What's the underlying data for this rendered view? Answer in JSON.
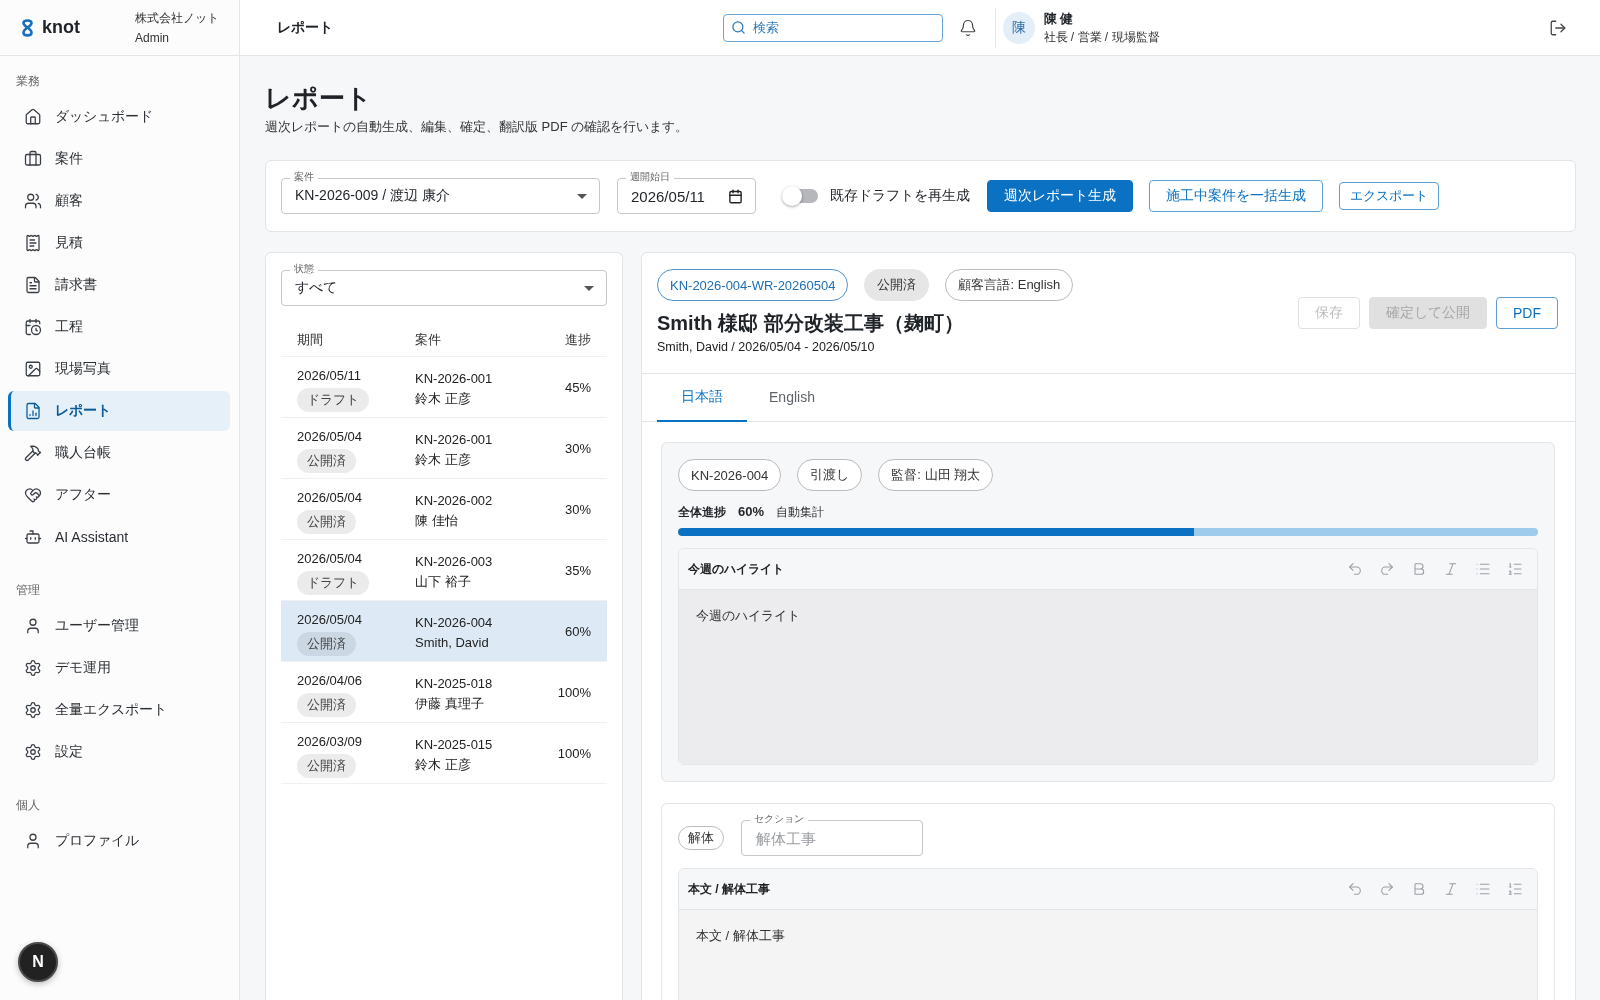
{
  "brand": {
    "name": "knot",
    "company": "株式会社ノット",
    "account": "Admin"
  },
  "sidebar": {
    "sections": [
      {
        "title": "業務",
        "items": [
          {
            "label": "ダッシュボード",
            "selected": false
          },
          {
            "label": "案件",
            "selected": false
          },
          {
            "label": "顧客",
            "selected": false
          },
          {
            "label": "見積",
            "selected": false
          },
          {
            "label": "請求書",
            "selected": false
          },
          {
            "label": "工程",
            "selected": false
          },
          {
            "label": "現場写真",
            "selected": false
          },
          {
            "label": "レポート",
            "selected": true
          },
          {
            "label": "職人台帳",
            "selected": false
          },
          {
            "label": "アフター",
            "selected": false
          },
          {
            "label": "AI Assistant",
            "selected": false
          }
        ]
      },
      {
        "title": "管理",
        "items": [
          {
            "label": "ユーザー管理",
            "selected": false
          },
          {
            "label": "デモ運用",
            "selected": false
          },
          {
            "label": "全量エクスポート",
            "selected": false
          },
          {
            "label": "設定",
            "selected": false
          }
        ]
      },
      {
        "title": "個人",
        "items": [
          {
            "label": "プロファイル",
            "selected": false
          }
        ]
      }
    ],
    "dev_badge": "N"
  },
  "header": {
    "title": "レポート",
    "search": {
      "placeholder": "検索"
    },
    "user": {
      "avatar": "陳",
      "name": "陳 健",
      "roles": "社長 / 営業 / 現場監督"
    }
  },
  "page": {
    "title": "レポート",
    "subtitle": "週次レポートの自動生成、編集、確定、翻訳版 PDF の確認を行います。"
  },
  "filters": {
    "project": {
      "label": "案件",
      "value": "KN-2026-009 / 渡辺 康介"
    },
    "week_start": {
      "label": "週開始日",
      "value": "2026/05/11"
    },
    "regenerate": {
      "label": "既存ドラフトを再生成",
      "on": false
    },
    "buttons": [
      {
        "label": "週次レポート生成",
        "kind": "contained"
      },
      {
        "label": "施工中案件を一括生成",
        "kind": "outlined"
      },
      {
        "label": "エクスポート",
        "kind": "small"
      }
    ]
  },
  "report_list": {
    "status_filter": {
      "label": "状態",
      "value": "すべて"
    },
    "columns": [
      "期間",
      "案件",
      "進捗"
    ],
    "rows": [
      {
        "period": "2026/05/11",
        "status": "ドラフト",
        "project": "KN-2026-001",
        "client": "鈴木 正彦",
        "progress": "45%",
        "selected": false
      },
      {
        "period": "2026/05/04",
        "status": "公開済",
        "project": "KN-2026-001",
        "client": "鈴木 正彦",
        "progress": "30%",
        "selected": false
      },
      {
        "period": "2026/05/04",
        "status": "公開済",
        "project": "KN-2026-002",
        "client": "陳 佳怡",
        "progress": "30%",
        "selected": false
      },
      {
        "period": "2026/05/04",
        "status": "ドラフト",
        "project": "KN-2026-003",
        "client": "山下 裕子",
        "progress": "35%",
        "selected": false
      },
      {
        "period": "2026/05/04",
        "status": "公開済",
        "project": "KN-2026-004",
        "client": "Smith, David",
        "progress": "60%",
        "selected": true
      },
      {
        "period": "2026/04/06",
        "status": "公開済",
        "project": "KN-2025-018",
        "client": "伊藤 真理子",
        "progress": "100%",
        "selected": false
      },
      {
        "period": "2026/03/09",
        "status": "公開済",
        "project": "KN-2025-015",
        "client": "鈴木 正彦",
        "progress": "100%",
        "selected": false
      }
    ]
  },
  "report": {
    "chips": [
      {
        "text": "KN-2026-004-WR-20260504",
        "kind": "primary"
      },
      {
        "text": "公開済",
        "kind": "filled"
      },
      {
        "text": "顧客言語: English",
        "kind": "outlined"
      }
    ],
    "title": "Smith 様邸 部分改装工事（麹町）",
    "subtitle": "Smith, David / 2026/05/04 - 2026/05/10",
    "actions": [
      {
        "label": "保存",
        "kind": "outlined",
        "disabled": true
      },
      {
        "label": "確定して公開",
        "kind": "contained",
        "disabled": true
      },
      {
        "label": "PDF",
        "kind": "outlined",
        "disabled": false
      }
    ],
    "tabs": [
      {
        "label": "日本語",
        "selected": true
      },
      {
        "label": "English",
        "selected": false
      }
    ],
    "summary": {
      "chips": [
        "KN-2026-004",
        "引渡し",
        "監督: 山田 翔太"
      ],
      "progress_label": "全体進捗",
      "progress_value": "60%",
      "level": 0.6,
      "progress_note": "自動集計",
      "editor": {
        "title": "今週のハイライト",
        "text": "今週のハイライト"
      }
    },
    "sections": [
      {
        "tag": "解体",
        "field": {
          "label": "セクション",
          "placeholder": "解体工事"
        },
        "editor": {
          "title": "本文 / 解体工事",
          "text": "本文 / 解体工事"
        }
      }
    ]
  }
}
